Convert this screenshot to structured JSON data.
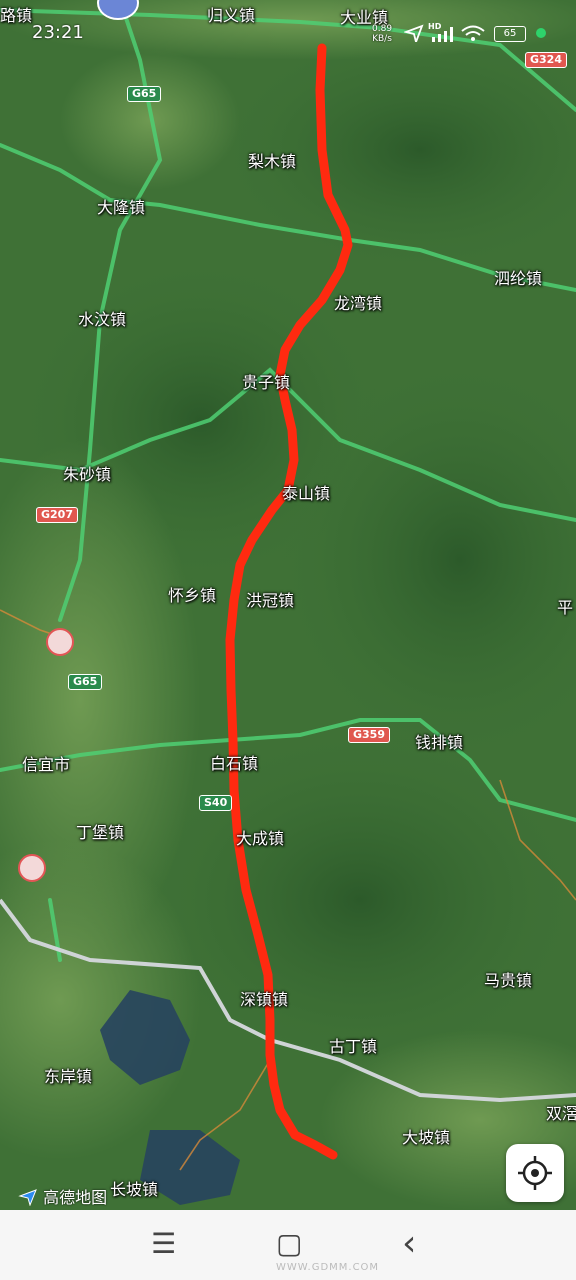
{
  "status_bar": {
    "time": "23:21",
    "net_speed_value": "0.89",
    "net_speed_unit": "KB/s",
    "network_type": "HD",
    "battery": "65"
  },
  "map": {
    "town_labels": {
      "luzhen": "路镇",
      "guiyi": "归义镇",
      "daye": "大业镇",
      "limu": "梨木镇",
      "dalong": "大隆镇",
      "silun": "泗纶镇",
      "longwan": "龙湾镇",
      "shuiwen": "水汶镇",
      "guizi": "贵子镇",
      "zhusha": "朱砂镇",
      "taishan": "泰山镇",
      "huaixiang": "怀乡镇",
      "hongguan": "洪冠镇",
      "ping": "平",
      "qianpai": "钱排镇",
      "xinyi": "信宜市",
      "baishi": "白石镇",
      "dingbao": "丁堡镇",
      "dacheng": "大成镇",
      "magui": "马贵镇",
      "shenzhen": "深镇镇",
      "guding": "古丁镇",
      "dongan": "东岸镇",
      "shuangjiao": "双滘",
      "dapo": "大坡镇",
      "changpo": "长坡镇"
    },
    "road_shields": {
      "g324": "G324",
      "g65_top": "G65",
      "g207": "G207",
      "g65_mid": "G65",
      "g359": "G359",
      "s40": "S40"
    },
    "route_color": "#ff2a10",
    "logo_text": "高德地图"
  },
  "nav_bar": {
    "menu_glyph": "☰",
    "home_glyph": "▢",
    "back_glyph": "‹"
  },
  "watermark": "WWW.GDMM.COM"
}
